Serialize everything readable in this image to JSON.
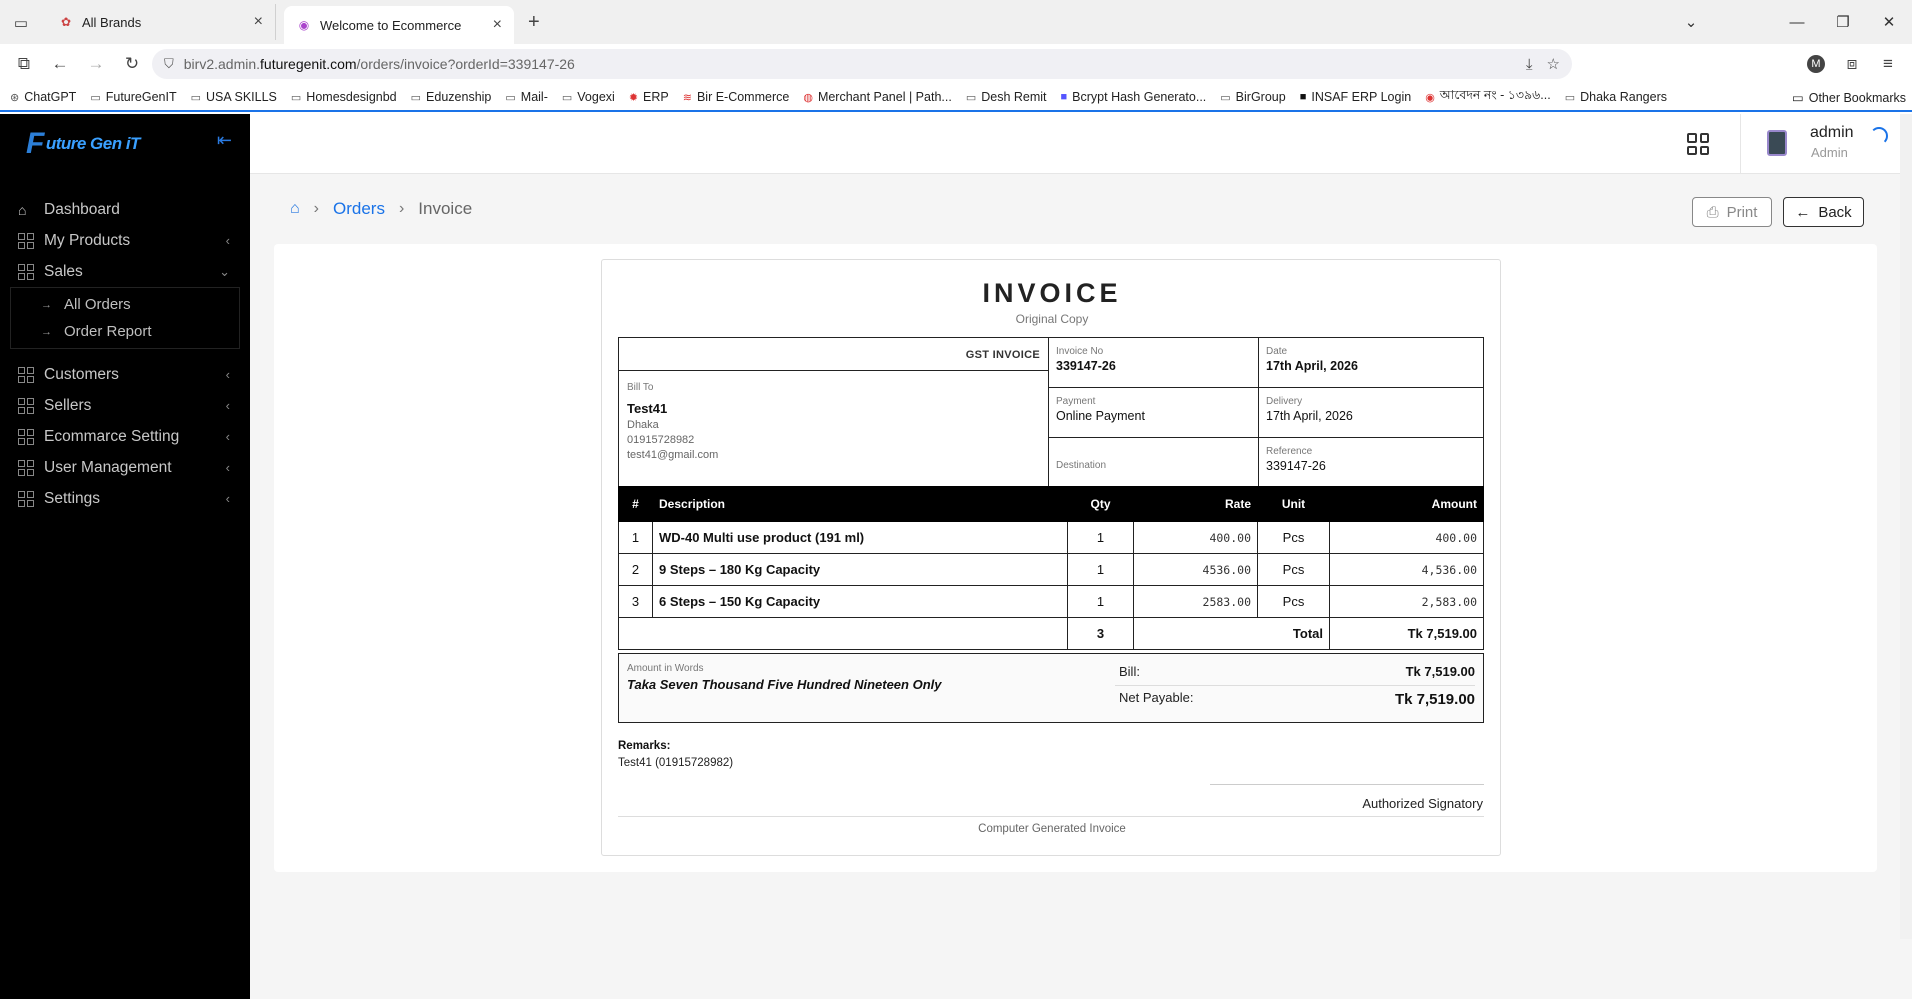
{
  "browser": {
    "tabs": [
      {
        "title": "All Brands"
      },
      {
        "title": "Welcome to Ecommerce"
      }
    ],
    "url_prefix": "birv2.admin.",
    "url_domain": "futuregenit.com",
    "url_path": "/orders/invoice?orderId=339147-26",
    "profile_initial": "M",
    "bookmarks": [
      "ChatGPT",
      "FutureGenIT",
      "USA SKILLS",
      "Homesdesignbd",
      "Eduzenship",
      "Mail-",
      "Vogexi",
      "ERP",
      "Bir E-Commerce",
      "Merchant Panel | Path...",
      "Desh Remit",
      "Bcrypt Hash Generato...",
      "BirGroup",
      "INSAF ERP Login",
      "আবেদন নং - ১৩৯৬...",
      "Dhaka Rangers"
    ],
    "other_bookmarks": "Other Bookmarks"
  },
  "sidebar": {
    "logo_letter": "F",
    "logo_text": "uture Gen iT",
    "items": [
      {
        "label": "Dashboard"
      },
      {
        "label": "My Products"
      },
      {
        "label": "Sales"
      },
      {
        "label": "Customers"
      },
      {
        "label": "Sellers"
      },
      {
        "label": "Ecommarce Setting"
      },
      {
        "label": "User Management"
      },
      {
        "label": "Settings"
      }
    ],
    "sales_sub": [
      {
        "label": "All Orders"
      },
      {
        "label": "Order Report"
      }
    ]
  },
  "topbar": {
    "user_name": "admin",
    "user_role": "Admin"
  },
  "breadcrumb": {
    "orders": "Orders",
    "current": "Invoice"
  },
  "actions": {
    "print": "Print",
    "back": "Back"
  },
  "invoice": {
    "title": "INVOICE",
    "subtitle": "Original Copy",
    "gst_label": "GST INVOICE",
    "bill_to_label": "Bill To",
    "customer_name": "Test41",
    "customer_city": "Dhaka",
    "customer_phone": "01915728982",
    "customer_email": "test41@gmail.com",
    "invoice_no_label": "Invoice No",
    "invoice_no": "339147-26",
    "date_label": "Date",
    "date": "17th April, 2026",
    "payment_label": "Payment",
    "payment": "Online Payment",
    "delivery_label": "Delivery",
    "delivery": "17th April, 2026",
    "destination_label": "Destination",
    "destination": "",
    "reference_label": "Reference",
    "reference": "339147-26",
    "columns": {
      "num": "#",
      "description": "Description",
      "qty": "Qty",
      "rate": "Rate",
      "unit": "Unit",
      "amount": "Amount"
    },
    "items": [
      {
        "num": "1",
        "description": "WD-40 Multi use product (191 ml)",
        "qty": "1",
        "rate": "400.00",
        "unit": "Pcs",
        "amount": "400.00"
      },
      {
        "num": "2",
        "description": "9 Steps – 180 Kg Capacity",
        "qty": "1",
        "rate": "4536.00",
        "unit": "Pcs",
        "amount": "4,536.00"
      },
      {
        "num": "3",
        "description": "6 Steps – 150 Kg Capacity",
        "qty": "1",
        "rate": "2583.00",
        "unit": "Pcs",
        "amount": "2,583.00"
      }
    ],
    "total_qty": "3",
    "total_label": "Total",
    "total_amount": "Tk 7,519.00",
    "amount_words_label": "Amount in Words",
    "amount_words": "Taka Seven Thousand Five Hundred Nineteen Only",
    "bill_label": "Bill:",
    "bill_value": "Tk 7,519.00",
    "net_payable_label": "Net Payable:",
    "net_payable_value": "Tk 7,519.00",
    "remarks_label": "Remarks:",
    "remarks": "Test41 (01915728982)",
    "signatory": "Authorized Signatory",
    "footer": "Computer Generated Invoice"
  },
  "colors": {
    "accent": "#1a73e8",
    "sidebar_bg": "#000000"
  }
}
